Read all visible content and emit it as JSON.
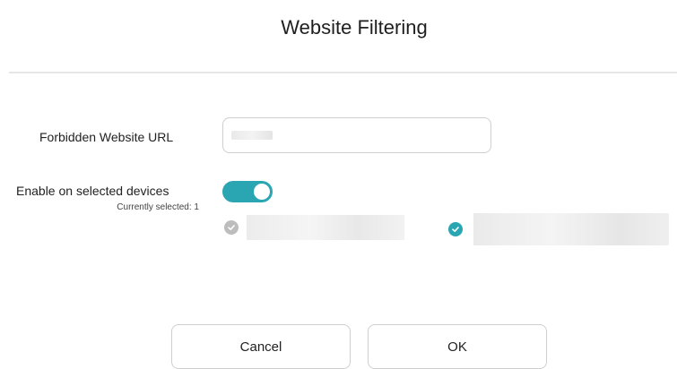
{
  "dialog": {
    "title": "Website Filtering"
  },
  "url_field": {
    "label": "Forbidden Website URL",
    "value": "",
    "placeholder": ""
  },
  "enable": {
    "label": "Enable on selected devices",
    "sub_label": "Currently selected: 1",
    "enabled": true
  },
  "devices": [
    {
      "icon": "check-circle-icon",
      "selected": false
    },
    {
      "icon": "check-circle-icon",
      "selected": true
    }
  ],
  "buttons": {
    "cancel_label": "Cancel",
    "ok_label": "OK"
  },
  "colors": {
    "accent": "#2aa6b3",
    "unselected": "#bdbdbd"
  }
}
